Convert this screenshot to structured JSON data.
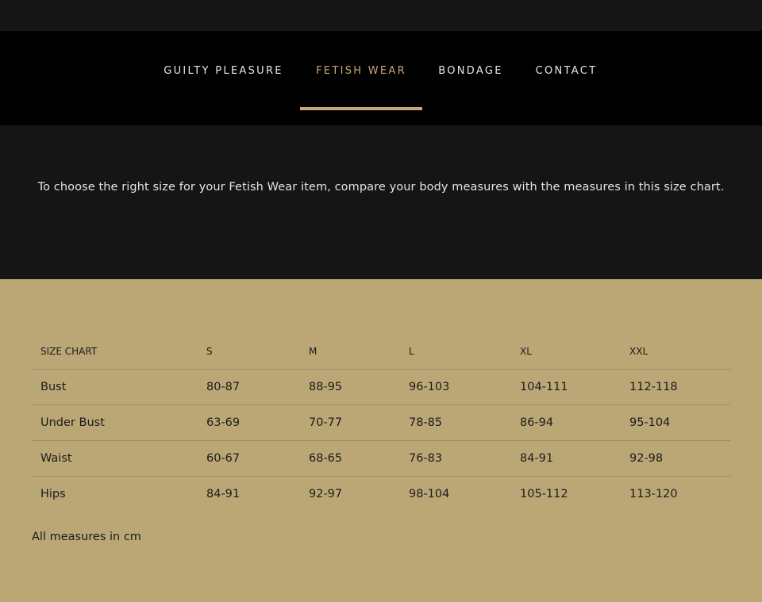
{
  "nav": {
    "items": [
      {
        "label": "GUILTY PLEASURE"
      },
      {
        "label": "FETISH WEAR",
        "active": true
      },
      {
        "label": "BONDAGE"
      },
      {
        "label": "CONTACT"
      }
    ]
  },
  "intro": {
    "text": "To choose the right size for your Fetish Wear item, compare your body measures with the measures in this size chart."
  },
  "size_chart": {
    "headers": [
      "SIZE CHART",
      "S",
      "M",
      "L",
      "XL",
      "XXL"
    ],
    "rows": [
      [
        "Bust",
        "80-87",
        "88-95",
        "96-103",
        "104-111",
        "112-118"
      ],
      [
        "Under Bust",
        "63-69",
        "70-77",
        "78-85",
        "86-94",
        "95-104"
      ],
      [
        "Waist",
        "60-67",
        "68-65",
        "76-83",
        "84-91",
        "92-98"
      ],
      [
        "Hips",
        "84-91",
        "92-97",
        "98-104",
        "105-112",
        "113-120"
      ]
    ],
    "note": "All measures in cm"
  },
  "colors": {
    "header_bg": "#000000",
    "intro_bg": "#151515",
    "accent": "#c9a77a",
    "section_bg": "#bba776"
  }
}
